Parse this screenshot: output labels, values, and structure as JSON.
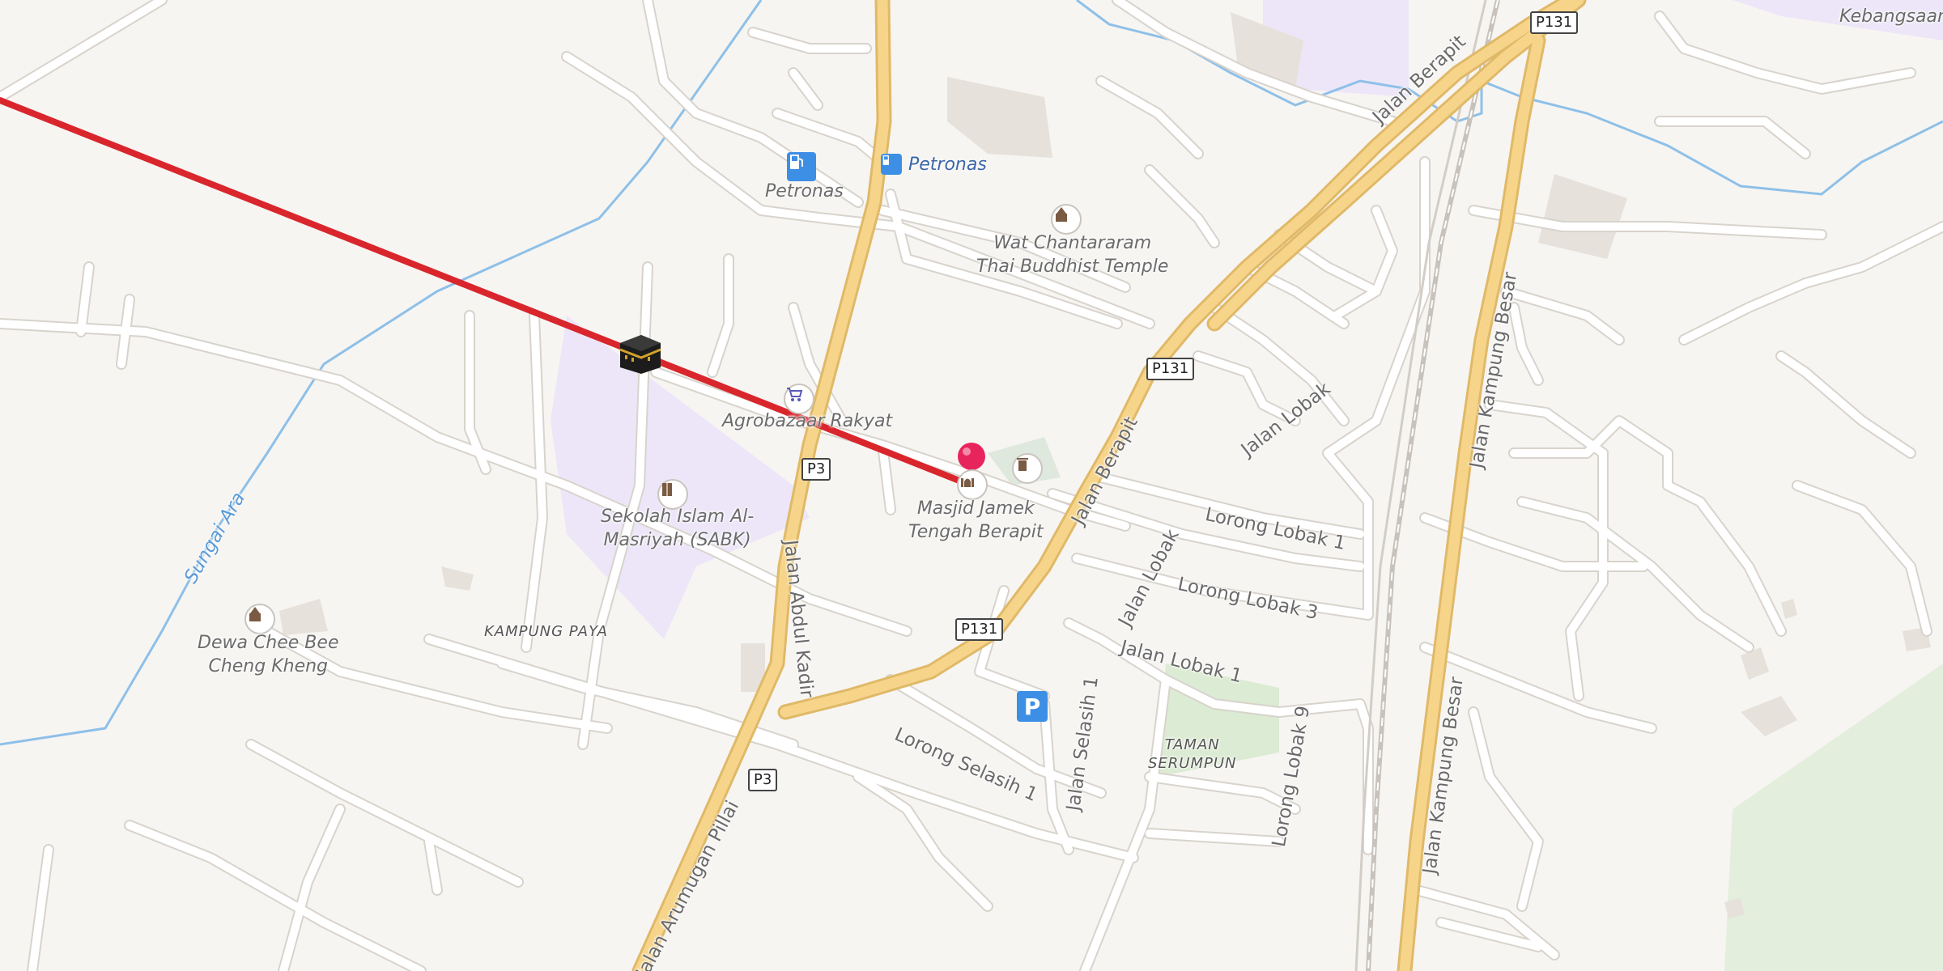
{
  "map": {
    "place_labels": {
      "petronas_1": "Petronas",
      "petronas_2": "Petronas",
      "wat_line1": "Wat Chantararam",
      "wat_line2": "Thai Buddhist Temple",
      "agrobazaar": "Agrobazaar Rakyat",
      "sekolah_line1": "Sekolah Islam Al-",
      "sekolah_line2": "Masriyah (SABK)",
      "masjid_line1": "Masjid Jamek",
      "masjid_line2": "Tengah Berapit",
      "dewa_line1": "Dewa Chee Bee",
      "dewa_line2": "Cheng Kheng",
      "kampung_paya": "KAMPUNG PAYA",
      "taman_line1": "TAMAN",
      "taman_line2": "SERUMPUN",
      "kebangsaan": "Kebangsaan"
    },
    "road_labels": {
      "jalan_berapit_top": "Jalan Berapit",
      "jalan_berapit_mid": "Jalan Berapit",
      "jalan_lobak_top": "Jalan Lobak",
      "jalan_lobak_mid": "Jalan Lobak",
      "lorong_lobak_1": "Lorong Lobak 1",
      "lorong_lobak_3": "Lorong Lobak 3",
      "jalan_lobak_1": "Jalan Lobak 1",
      "lorong_lobak_9": "Lorong Lobak 9",
      "jalan_selasih_1": "Jalan Selasih 1",
      "lorong_selasih_1": "Lorong Selasih 1",
      "jalan_abdul_kadir": "Jalan Abdul Kadir",
      "jalan_arumugan_pillai": "Jalan Arumugan Pillai",
      "jalan_kampung_besar_top": "Jalan Kampung Besar",
      "jalan_kampung_besar_bottom": "Jalan Kampung Besar",
      "sungai_ara": "Sungai Ara"
    },
    "shields": {
      "p131_top": "P131",
      "p131_mid": "P131",
      "p131_low": "P131",
      "p3_mid": "P3",
      "p3_low": "P3"
    },
    "icons": {
      "parking": "P",
      "route_line": "qibla-direction-line",
      "kaaba": "kaaba-marker-icon",
      "pin": "location-pin-icon"
    },
    "colors": {
      "background": "#f7f5f2",
      "major_road": "#f6d58b",
      "route_line": "#d9262c",
      "pin": "#e8245c",
      "water": "#8ec0e8",
      "park": "#dcebd3",
      "school_area": "#ece6f8",
      "parking": "#3d8fe6"
    }
  }
}
